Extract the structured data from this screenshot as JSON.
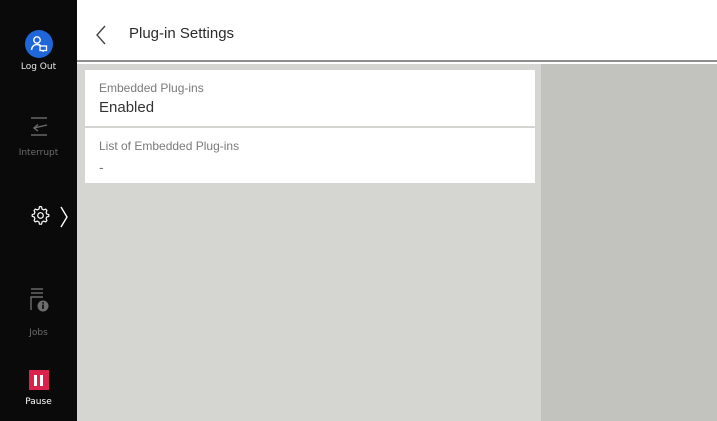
{
  "sidebar": {
    "logout_label": "Log Out",
    "interrupt_label": "Interrupt",
    "jobs_label": "Jobs",
    "pause_label": "Pause"
  },
  "header": {
    "title": "Plug-in Settings"
  },
  "settings_list": [
    {
      "label": "Embedded Plug-ins",
      "value": "Enabled"
    },
    {
      "label": "List of Embedded Plug-ins",
      "value": "-"
    }
  ],
  "colors": {
    "sidebar_bg": "#0a0a0a",
    "logout_accent": "#1f67d8",
    "pause_accent": "#d9234c",
    "content_bg": "#d5d5d1",
    "right_panel_bg": "#c2c2be"
  },
  "icons": {
    "logout": "user-switch-icon",
    "interrupt": "interrupt-icon",
    "settings": "gear-icon",
    "jobs": "jobs-icon",
    "pause": "pause-icon",
    "back": "chevron-left-icon"
  }
}
